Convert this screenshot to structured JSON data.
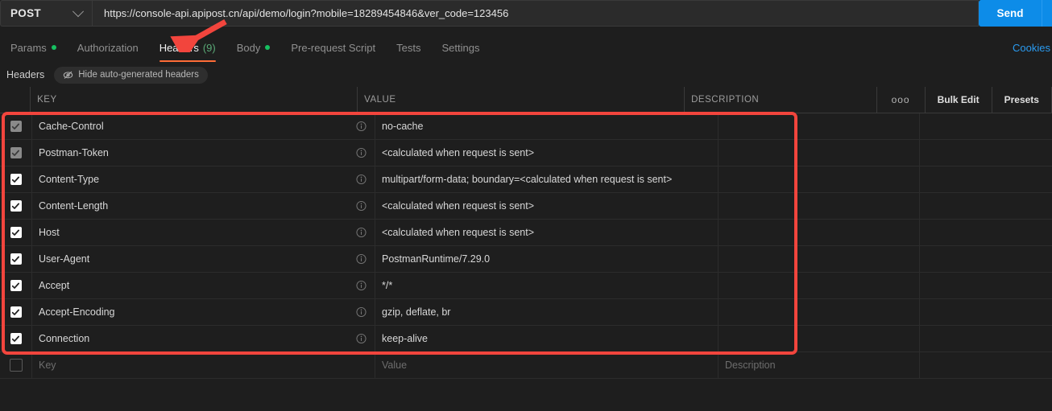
{
  "request": {
    "method": "POST",
    "method_icon": "chevron-down-icon",
    "url": "https://console-api.apipost.cn/api/demo/login?mobile=18289454846&ver_code=123456",
    "send_label": "Send"
  },
  "tabs": [
    {
      "label": "Params",
      "dot": true,
      "active": false
    },
    {
      "label": "Authorization",
      "dot": false,
      "active": false
    },
    {
      "label": "Headers",
      "count": "(9)",
      "dot": false,
      "active": true
    },
    {
      "label": "Body",
      "dot": true,
      "active": false
    },
    {
      "label": "Pre-request Script",
      "dot": false,
      "active": false
    },
    {
      "label": "Tests",
      "dot": false,
      "active": false
    },
    {
      "label": "Settings",
      "dot": false,
      "active": false
    }
  ],
  "cookies_link": "Cookies",
  "subbar": {
    "title": "Headers",
    "hide_auto_label": "Hide auto-generated headers",
    "hide_auto_icon": "eye-slash-icon"
  },
  "table": {
    "columns": {
      "key": "KEY",
      "value": "VALUE",
      "description": "DESCRIPTION"
    },
    "tools": {
      "more_label": "ooo",
      "more_icon": "ellipsis-icon",
      "bulk_edit": "Bulk Edit",
      "presets": "Presets"
    },
    "rows": [
      {
        "checked": true,
        "dim": true,
        "key": "Cache-Control",
        "value": "no-cache",
        "description": "",
        "info_icon": "info-icon"
      },
      {
        "checked": true,
        "dim": true,
        "key": "Postman-Token",
        "value": "<calculated when request is sent>",
        "description": "",
        "info_icon": "info-icon"
      },
      {
        "checked": true,
        "dim": false,
        "key": "Content-Type",
        "value": "multipart/form-data; boundary=<calculated when request is sent>",
        "description": "",
        "info_icon": "info-icon"
      },
      {
        "checked": true,
        "dim": false,
        "key": "Content-Length",
        "value": "<calculated when request is sent>",
        "description": "",
        "info_icon": "info-icon"
      },
      {
        "checked": true,
        "dim": false,
        "key": "Host",
        "value": "<calculated when request is sent>",
        "description": "",
        "info_icon": "info-icon"
      },
      {
        "checked": true,
        "dim": false,
        "key": "User-Agent",
        "value": "PostmanRuntime/7.29.0",
        "description": "",
        "info_icon": "info-icon"
      },
      {
        "checked": true,
        "dim": false,
        "key": "Accept",
        "value": "*/*",
        "description": "",
        "info_icon": "info-icon"
      },
      {
        "checked": true,
        "dim": false,
        "key": "Accept-Encoding",
        "value": "gzip, deflate, br",
        "description": "",
        "info_icon": "info-icon"
      },
      {
        "checked": true,
        "dim": false,
        "key": "Connection",
        "value": "keep-alive",
        "description": "",
        "info_icon": "info-icon"
      }
    ],
    "new_row": {
      "key_placeholder": "Key",
      "value_placeholder": "Value",
      "description_placeholder": "Description"
    }
  },
  "annotations": {
    "highlight_color": "#f2453d",
    "arrow_target": "headers-tab",
    "rect_target": "headers-table-rows"
  },
  "colors": {
    "accent_orange": "#ff6c37",
    "send_blue": "#0d8ce8",
    "link_blue": "#2a9bf0",
    "dot_green": "#16c060",
    "background": "#1e1e1e"
  }
}
